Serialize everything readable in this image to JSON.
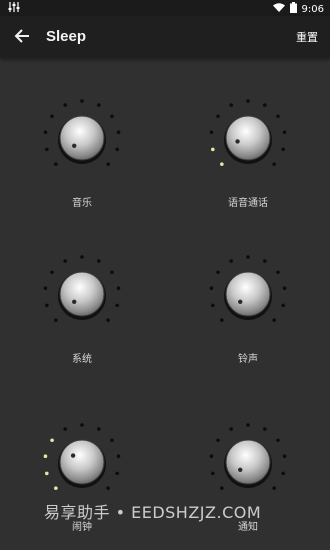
{
  "status_bar": {
    "time": "9:06",
    "left_icon": "sliders-icon"
  },
  "app_bar": {
    "title": "Sleep",
    "reset_label": "重置",
    "back_icon": "arrow-left-icon"
  },
  "knobs": [
    {
      "id": "music",
      "label": "音乐",
      "level": 0
    },
    {
      "id": "voice-call",
      "label": "语音通话",
      "level": 2
    },
    {
      "id": "system",
      "label": "系统",
      "level": 0
    },
    {
      "id": "ringtone",
      "label": "铃声",
      "level": 0
    },
    {
      "id": "alarm",
      "label": "闹钟",
      "level": 4
    },
    {
      "id": "notification",
      "label": "通知",
      "level": 0
    }
  ],
  "colors": {
    "active_dot": "#e8e7a2",
    "inactive_dot": "#0c0c0c",
    "background": "#303030"
  },
  "watermark": "易享助手 • EEDSHZJZ.COM"
}
